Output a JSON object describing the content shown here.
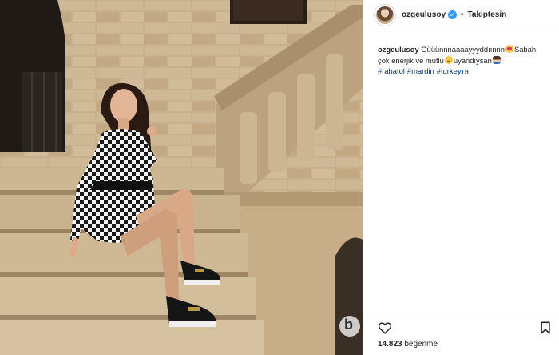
{
  "post": {
    "username": "ozgeulusoy",
    "separator": "•",
    "follow_label": "Takiptesin",
    "verified_mark": "✓"
  },
  "caption": {
    "username": "ozgeulusoy",
    "part1": "Güüünnnaaaayyyddıınnn",
    "part2": "Sabah çok enerjik ve mutlu",
    "part3": "uyandıysan",
    "hashtags": [
      "#rahatol",
      "#mardin",
      "#turkeyтя"
    ]
  },
  "likes": {
    "count": "14.823",
    "label": "beğenme"
  },
  "photo": {
    "watermark": "b"
  },
  "icons": {
    "like": "heart-icon",
    "save": "bookmark-icon",
    "verified": "verified-badge-icon"
  },
  "colors": {
    "verified": "#3897f0",
    "hashtag": "#003569",
    "text": "#262626",
    "border": "#efefef"
  }
}
